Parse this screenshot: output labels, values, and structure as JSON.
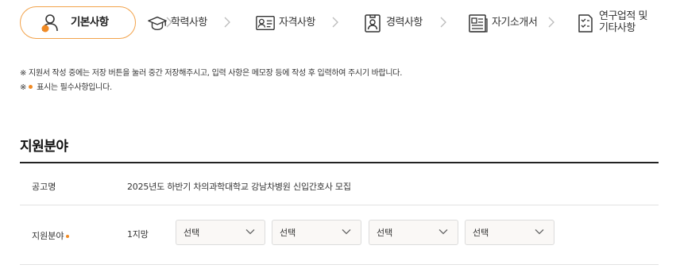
{
  "steps": [
    {
      "label": "기본사항",
      "icon": "person-icon",
      "active": true
    },
    {
      "label": "학력사항",
      "icon": "graduation-cap-icon",
      "active": false
    },
    {
      "label": "자격사항",
      "icon": "id-card-icon",
      "active": false
    },
    {
      "label": "경력사항",
      "icon": "badge-icon",
      "active": false
    },
    {
      "label": "자기소개서",
      "icon": "document-icon",
      "active": false
    },
    {
      "label_line1": "연구업적 및",
      "label_line2": "기타사항",
      "icon": "checklist-icon",
      "active": false
    }
  ],
  "notices": {
    "line1": "※ 지원서 작성 중에는 저장 버튼을 눌러 중간 저장해주시고, 입력 사항은 메모장 등에 작성 후 입력하여 주시기 바랍니다.",
    "line2_prefix": "※",
    "line2_text": "표시는 필수사항입니다."
  },
  "section": {
    "title": "지원분야",
    "rows": {
      "notice_label": "공고명",
      "notice_value": "2025년도 하반기 차의과학대학교 강남차병원 신입간호사 모집",
      "field_label": "지원분야",
      "preference_label": "1지망"
    },
    "selects": [
      "선택",
      "선택",
      "선택",
      "선택"
    ]
  },
  "colors": {
    "accent": "#f2a24a",
    "required_dot": "#f08a24",
    "text": "#333333",
    "select_bg": "#faf8f6"
  }
}
